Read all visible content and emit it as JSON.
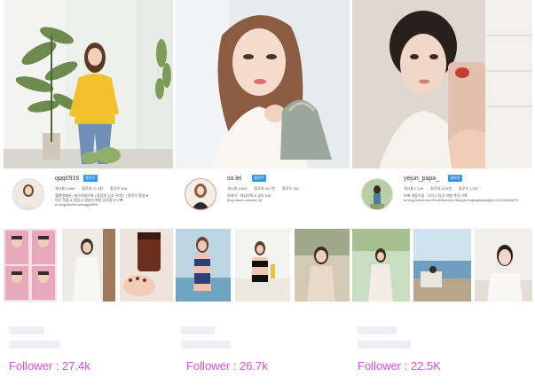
{
  "colors": {
    "follower_text": "#d94cdb",
    "follow_button": "#3897f0"
  },
  "influencers": [
    {
      "username": "qqq0916",
      "follow_label": "팔로우",
      "stats": [
        "게시물 3,884",
        "팔로워 27.4천",
        "팔로우 308"
      ],
      "bio": [
        "헬렌앤패션 | 대구데일리룩 | 즐겁게 입고 꾸미는 | 팔로우 환영 ♥",
        "대구 핫플 & 맛집 & 데일리 패션 공유합니다 ❤",
        "m.blog.naver.com/qqq0916"
      ],
      "follower": "Follower : 27.4k"
    },
    {
      "username": "so.lei",
      "follow_label": "팔로우",
      "stats": [
        "게시물 1,624",
        "팔로워 26.7천",
        "팔로우 282"
      ],
      "bio": [
        "쏘레이 · 데일리룩 & 뷰티 DM",
        "blog.naver.com/sol_ei"
      ],
      "follower": "Follower : 26.7k"
    },
    {
      "username": "yejun_papa_",
      "follow_label": "팔로우",
      "stats": [
        "게시물 2,139",
        "팔로워 22.5천",
        "팔로우 1,057"
      ],
      "bio": [
        "보배 쌍둥이맘 · 그리고 일상 여행 육아 기록",
        "m.blog.naver.com/PostView.nhn?blogId=hujanglim&logNo=22125284979"
      ],
      "follower": "Follower : 22.5K"
    }
  ]
}
